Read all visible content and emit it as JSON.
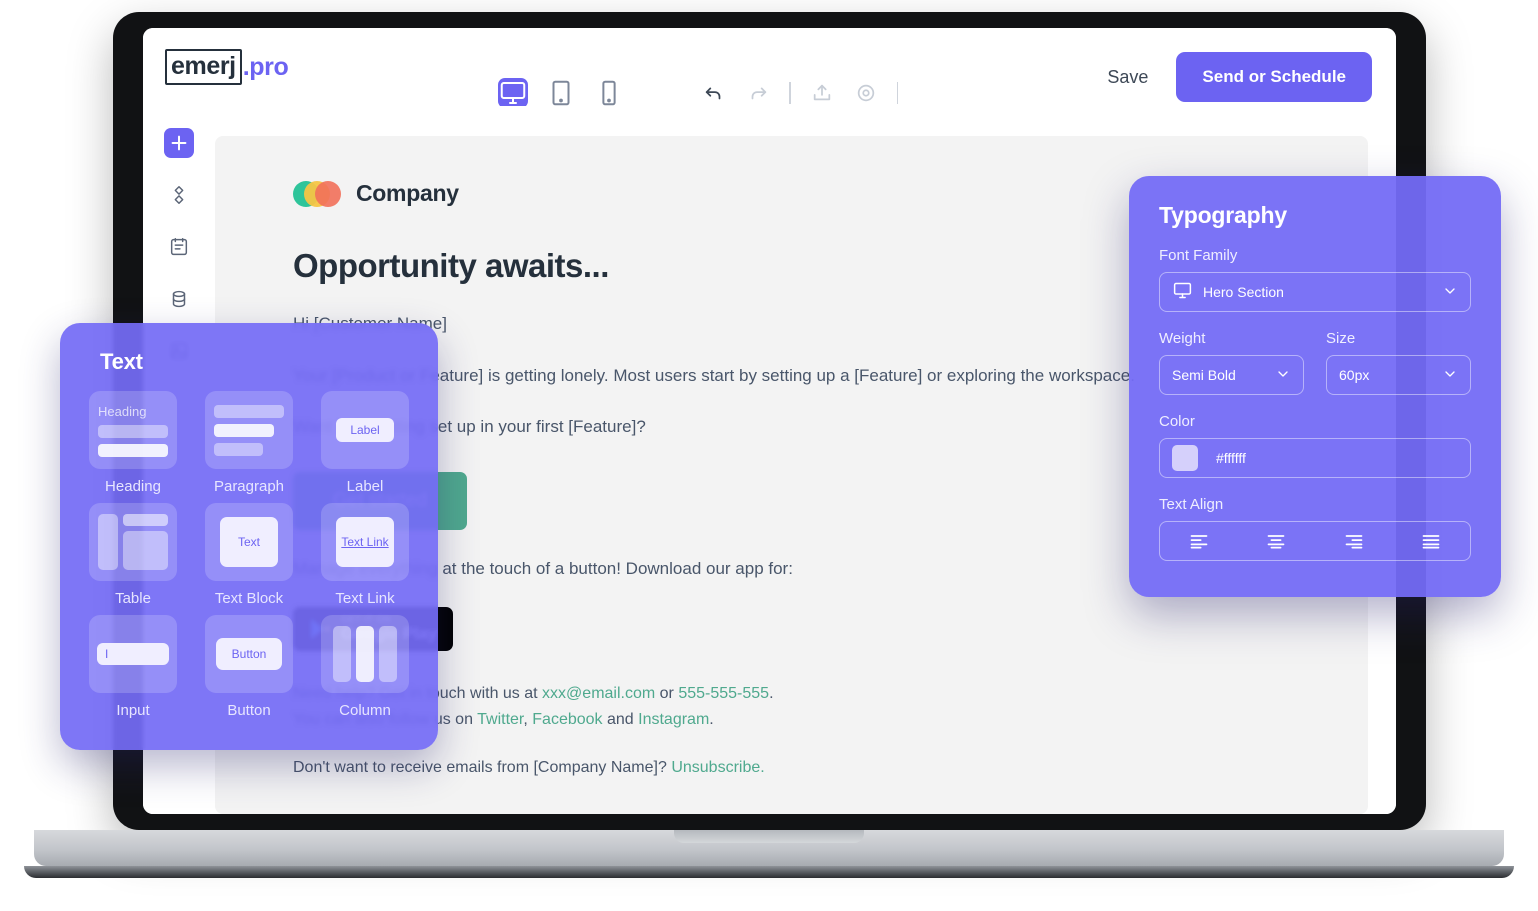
{
  "app": {
    "logo_main": "emerj",
    "logo_suffix": ".pro",
    "device_toggles": [
      {
        "name": "desktop",
        "icon": "monitor-icon",
        "active": true
      },
      {
        "name": "tablet",
        "icon": "tablet-icon",
        "active": false
      },
      {
        "name": "mobile",
        "icon": "mobile-icon",
        "active": false
      }
    ],
    "history_tools": [
      {
        "name": "undo",
        "icon": "undo-icon",
        "state": "enabled"
      },
      {
        "name": "redo",
        "icon": "redo-icon",
        "state": "disabled"
      },
      {
        "name": "share",
        "icon": "share-icon",
        "state": "enabled"
      },
      {
        "name": "preview",
        "icon": "eye-icon",
        "state": "enabled"
      }
    ],
    "save_label": "Save",
    "send_label": "Send or Schedule",
    "accent_color": "#6c63f2"
  },
  "sidebar": {
    "items": [
      {
        "name": "add",
        "icon": "plus-icon",
        "active": true
      },
      {
        "name": "blocks",
        "icon": "diamond-blocks-icon",
        "active": false
      },
      {
        "name": "content",
        "icon": "note-icon",
        "active": false
      },
      {
        "name": "data",
        "icon": "database-icon",
        "active": false
      },
      {
        "name": "media",
        "icon": "image-icon",
        "active": false
      }
    ]
  },
  "email": {
    "company_name": "Company",
    "logo_colors": [
      "#2ec49a",
      "#f5c544",
      "#f2705a"
    ],
    "heading": "Opportunity awaits...",
    "greeting": "Hi [Customer Name]",
    "paragraph1": "Your [Product or Feature] is getting lonely. Most users start by setting up a [Feature] or exploring the workspace.",
    "paragraph2": "Want help getting set up in your first [Feature]?",
    "cta_label": "Get started",
    "cta_color": "#4fa98e",
    "app_line": "Manage everything at the touch of a button! Download our app for:",
    "store_badges": [
      {
        "small": "GET IT ON",
        "big": "Google Play"
      }
    ],
    "footer_line1_pre": "Need help? Get in touch with us at ",
    "footer_email": "xxx@email.com",
    "footer_line1_mid": " or ",
    "footer_phone": "555-555-555",
    "footer_line1_post": ".",
    "footer_line2_pre": "You can also follow us on ",
    "footer_social1": "Twitter",
    "footer_social_sep1": ", ",
    "footer_social2": "Facebook",
    "footer_social_sep2": " and ",
    "footer_social3": "Instagram",
    "footer_line2_post": ".",
    "footer_line3_pre": "Don't want to receive emails from [Company Name]? ",
    "footer_unsubscribe": "Unsubscribe.",
    "link_color": "#4fa98e"
  },
  "text_panel": {
    "title": "Text",
    "tiles": [
      {
        "label": "Heading",
        "sample": "Heading"
      },
      {
        "label": "Paragraph",
        "sample": ""
      },
      {
        "label": "Label",
        "sample": "Label"
      },
      {
        "label": "Table",
        "sample": ""
      },
      {
        "label": "Text Block",
        "sample": "Text"
      },
      {
        "label": "Text Link",
        "sample": "Text Link"
      },
      {
        "label": "Input",
        "sample": "I"
      },
      {
        "label": "Button",
        "sample": "Button"
      },
      {
        "label": "Column",
        "sample": ""
      }
    ]
  },
  "typography_panel": {
    "title": "Typography",
    "font_family_label": "Font Family",
    "font_family_value": "Hero Section",
    "weight_label": "Weight",
    "weight_value": "Semi Bold",
    "size_label": "Size",
    "size_value": "60px",
    "color_label": "Color",
    "color_value": "#ffffff",
    "swatch_color": "#d5d0fb",
    "text_align_label": "Text Align",
    "align_options": [
      "align-left",
      "align-center",
      "align-right",
      "align-justify"
    ]
  }
}
